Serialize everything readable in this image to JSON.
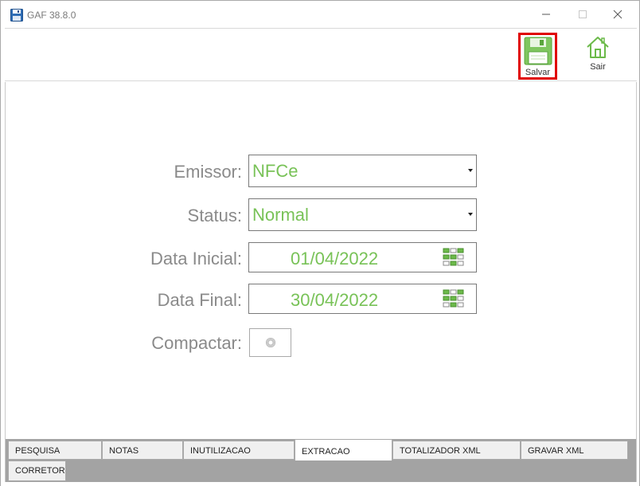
{
  "window": {
    "title": "GAF 38.8.0"
  },
  "toolbar": {
    "save_label": "Salvar",
    "exit_label": "Sair"
  },
  "form": {
    "emissor": {
      "label": "Emissor:",
      "value": "NFCe"
    },
    "status": {
      "label": "Status:",
      "value": "Normal"
    },
    "data_inicial": {
      "label": "Data Inicial:",
      "value": "01/04/2022"
    },
    "data_final": {
      "label": "Data Final:",
      "value": "30/04/2022"
    },
    "compactar": {
      "label": "Compactar:"
    }
  },
  "tabs": [
    {
      "label": "PESQUISA"
    },
    {
      "label": "NOTAS"
    },
    {
      "label": "INUTILIZACAO"
    },
    {
      "label": "EXTRACAO",
      "active": true
    },
    {
      "label": "TOTALIZADOR XML"
    },
    {
      "label": "GRAVAR XML"
    },
    {
      "label": "CORRETOR"
    }
  ],
  "colors": {
    "accent_green": "#78c257",
    "highlight_red": "#e00000",
    "label_gray": "#8a8a8a"
  },
  "icons": {
    "app": "floppy-disk-icon",
    "save": "floppy-disk-icon",
    "exit": "home-icon",
    "calendar": "calendar-icon"
  }
}
